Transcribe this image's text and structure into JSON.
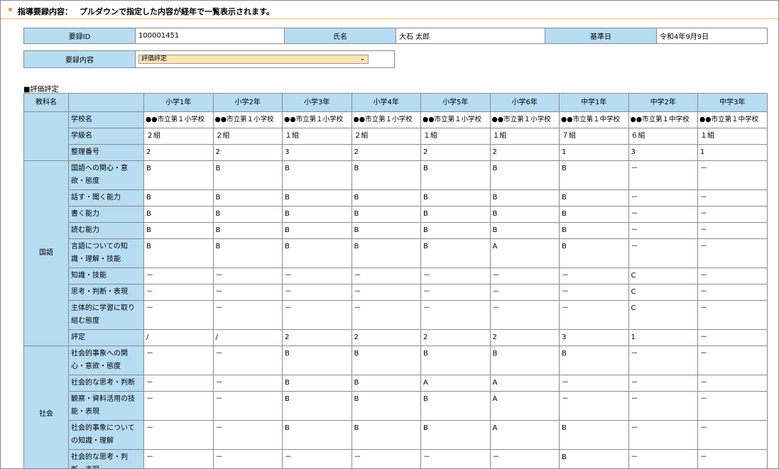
{
  "header": {
    "title": "指導要録内容：",
    "description": "プルダウンで指定した内容が経年で一覧表示されます。"
  },
  "info": {
    "id_label": "要録ID",
    "id_value": "100001451",
    "name_label": "氏名",
    "name_value": "大石 太郎",
    "date_label": "基準日",
    "date_value": "令和4年9月9日"
  },
  "selector": {
    "label": "要録内容",
    "value": "評価評定"
  },
  "section_title": "■評価評定",
  "grid": {
    "subject_header": "教科名",
    "years": [
      "小学1年",
      "小学2年",
      "小学3年",
      "小学4年",
      "小学5年",
      "小学6年",
      "中学1年",
      "中学2年",
      "中学3年"
    ],
    "meta_rows": [
      {
        "label": "学校名",
        "values": [
          "●●市立第１小学校",
          "●●市立第１小学校",
          "●●市立第１小学校",
          "●●市立第１小学校",
          "●●市立第１小学校",
          "●●市立第１小学校",
          "●●市立第１中学校",
          "●●市立第１中学校",
          "●●市立第１中学校"
        ]
      },
      {
        "label": "学級名",
        "values": [
          "２組",
          "２組",
          "１組",
          "２組",
          "１組",
          "１組",
          "７組",
          "６組",
          "１組"
        ]
      },
      {
        "label": "整理番号",
        "values": [
          "2",
          "2",
          "3",
          "2",
          "2",
          "2",
          "1",
          "3",
          "1"
        ]
      }
    ],
    "subjects": [
      {
        "name": "国語",
        "rows": [
          {
            "label": "国語への関心・意欲・態度",
            "values": [
              "B",
              "B",
              "B",
              "B",
              "B",
              "B",
              "B",
              "－",
              "－"
            ]
          },
          {
            "label": "話す・聞く能力",
            "values": [
              "B",
              "B",
              "B",
              "B",
              "B",
              "B",
              "B",
              "－",
              "－"
            ]
          },
          {
            "label": "書く能力",
            "values": [
              "B",
              "B",
              "B",
              "B",
              "B",
              "B",
              "B",
              "－",
              "－"
            ]
          },
          {
            "label": "読む能力",
            "values": [
              "B",
              "B",
              "B",
              "B",
              "B",
              "B",
              "B",
              "－",
              "－"
            ]
          },
          {
            "label": "言語についての知識・理解・技能",
            "values": [
              "B",
              "B",
              "B",
              "B",
              "B",
              "A",
              "B",
              "－",
              "－"
            ]
          },
          {
            "label": "知識・技能",
            "values": [
              "－",
              "－",
              "－",
              "－",
              "－",
              "－",
              "－",
              "C",
              "－"
            ]
          },
          {
            "label": "思考・判断・表現",
            "values": [
              "－",
              "－",
              "－",
              "－",
              "－",
              "－",
              "－",
              "C",
              "－"
            ]
          },
          {
            "label": "主体的に学習に取り組む態度",
            "values": [
              "－",
              "－",
              "－",
              "－",
              "－",
              "－",
              "－",
              "C",
              "－"
            ]
          },
          {
            "label": "評定",
            "values": [
              "/",
              "/",
              "2",
              "2",
              "2",
              "2",
              "3",
              "1",
              "－"
            ]
          }
        ]
      },
      {
        "name": "社会",
        "rows": [
          {
            "label": "社会的事象への関心・意欲・態度",
            "values": [
              "－",
              "－",
              "B",
              "B",
              "B",
              "B",
              "B",
              "－",
              "－"
            ]
          },
          {
            "label": "社会的な思考・判断",
            "values": [
              "－",
              "－",
              "B",
              "B",
              "A",
              "A",
              "－",
              "－",
              "－"
            ]
          },
          {
            "label": "観察・資料活用の技能・表現",
            "values": [
              "－",
              "－",
              "B",
              "B",
              "B",
              "A",
              "－",
              "－",
              "－"
            ]
          },
          {
            "label": "社会的事象についての知識・理解",
            "values": [
              "－",
              "－",
              "B",
              "B",
              "B",
              "A",
              "B",
              "－",
              "－"
            ]
          },
          {
            "label": "社会的な思考・判断・表現",
            "values": [
              "－",
              "－",
              "－",
              "－",
              "－",
              "－",
              "B",
              "－",
              "－"
            ]
          },
          {
            "label": "",
            "values": [
              "",
              "",
              "",
              "",
              "",
              "",
              "",
              "",
              ""
            ]
          }
        ]
      }
    ]
  }
}
